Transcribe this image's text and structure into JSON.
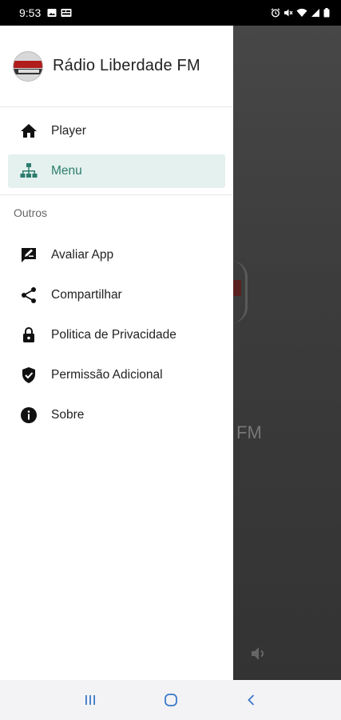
{
  "status_bar": {
    "time": "9:53",
    "left_icons": [
      "image-icon",
      "notification-icon"
    ],
    "right_icons": [
      "alarm-icon",
      "mute-icon",
      "wifi-icon",
      "signal-icon",
      "battery-icon"
    ]
  },
  "background": {
    "station_suffix": "FM"
  },
  "drawer": {
    "header": {
      "title": "Rádio Liberdade FM"
    },
    "primary_items": [
      {
        "label": "Player",
        "icon": "home-icon",
        "active": false
      },
      {
        "label": "Menu",
        "icon": "sitemap-icon",
        "active": true
      }
    ],
    "section_label": "Outros",
    "secondary_items": [
      {
        "label": "Avaliar App",
        "icon": "rate-icon"
      },
      {
        "label": "Compartilhar",
        "icon": "share-icon"
      },
      {
        "label": "Politica de Privacidade",
        "icon": "lock-icon"
      },
      {
        "label": "Permissão Adicional",
        "icon": "shield-check-icon"
      },
      {
        "label": "Sobre",
        "icon": "info-icon"
      }
    ]
  },
  "navigation_bar": [
    "recent-apps-icon",
    "home-circle-icon",
    "back-icon"
  ],
  "colors": {
    "accent": "#2c7d6d",
    "active_bg": "#e4f1ee",
    "scrim": "#3c3c3c"
  }
}
